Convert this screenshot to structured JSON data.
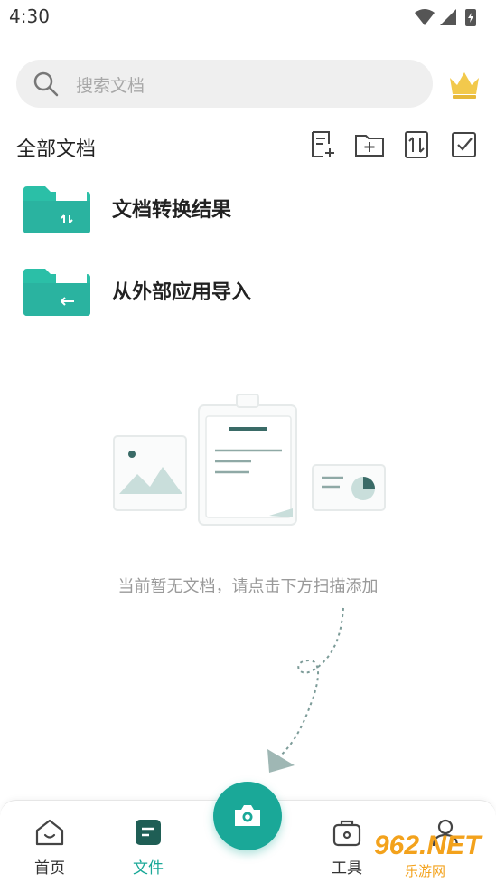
{
  "status_bar": {
    "time": "4:30"
  },
  "search": {
    "placeholder": "搜索文档"
  },
  "header": {
    "title": "全部文档",
    "icons": [
      "new-document-icon",
      "new-folder-icon",
      "sort-icon",
      "multi-select-icon"
    ]
  },
  "folders": [
    {
      "label": "文档转换结果",
      "icon": "folder-transfer-icon"
    },
    {
      "label": "从外部应用导入",
      "icon": "folder-import-icon"
    }
  ],
  "empty_state": {
    "message": "当前暂无文档，请点击下方扫描添加"
  },
  "bottom_nav": {
    "items": [
      {
        "label": "首页",
        "icon": "home-icon",
        "active": false
      },
      {
        "label": "文件",
        "icon": "file-icon",
        "active": true
      },
      {
        "label": "工具",
        "icon": "toolbox-icon",
        "active": false
      },
      {
        "label": "",
        "icon": "profile-icon",
        "active": false
      }
    ]
  },
  "watermark": {
    "line1": "962.NET",
    "line2": "乐游网"
  },
  "colors": {
    "accent": "#1aa898",
    "crown": "#f2c94c",
    "folder": "#2bbfa7"
  }
}
